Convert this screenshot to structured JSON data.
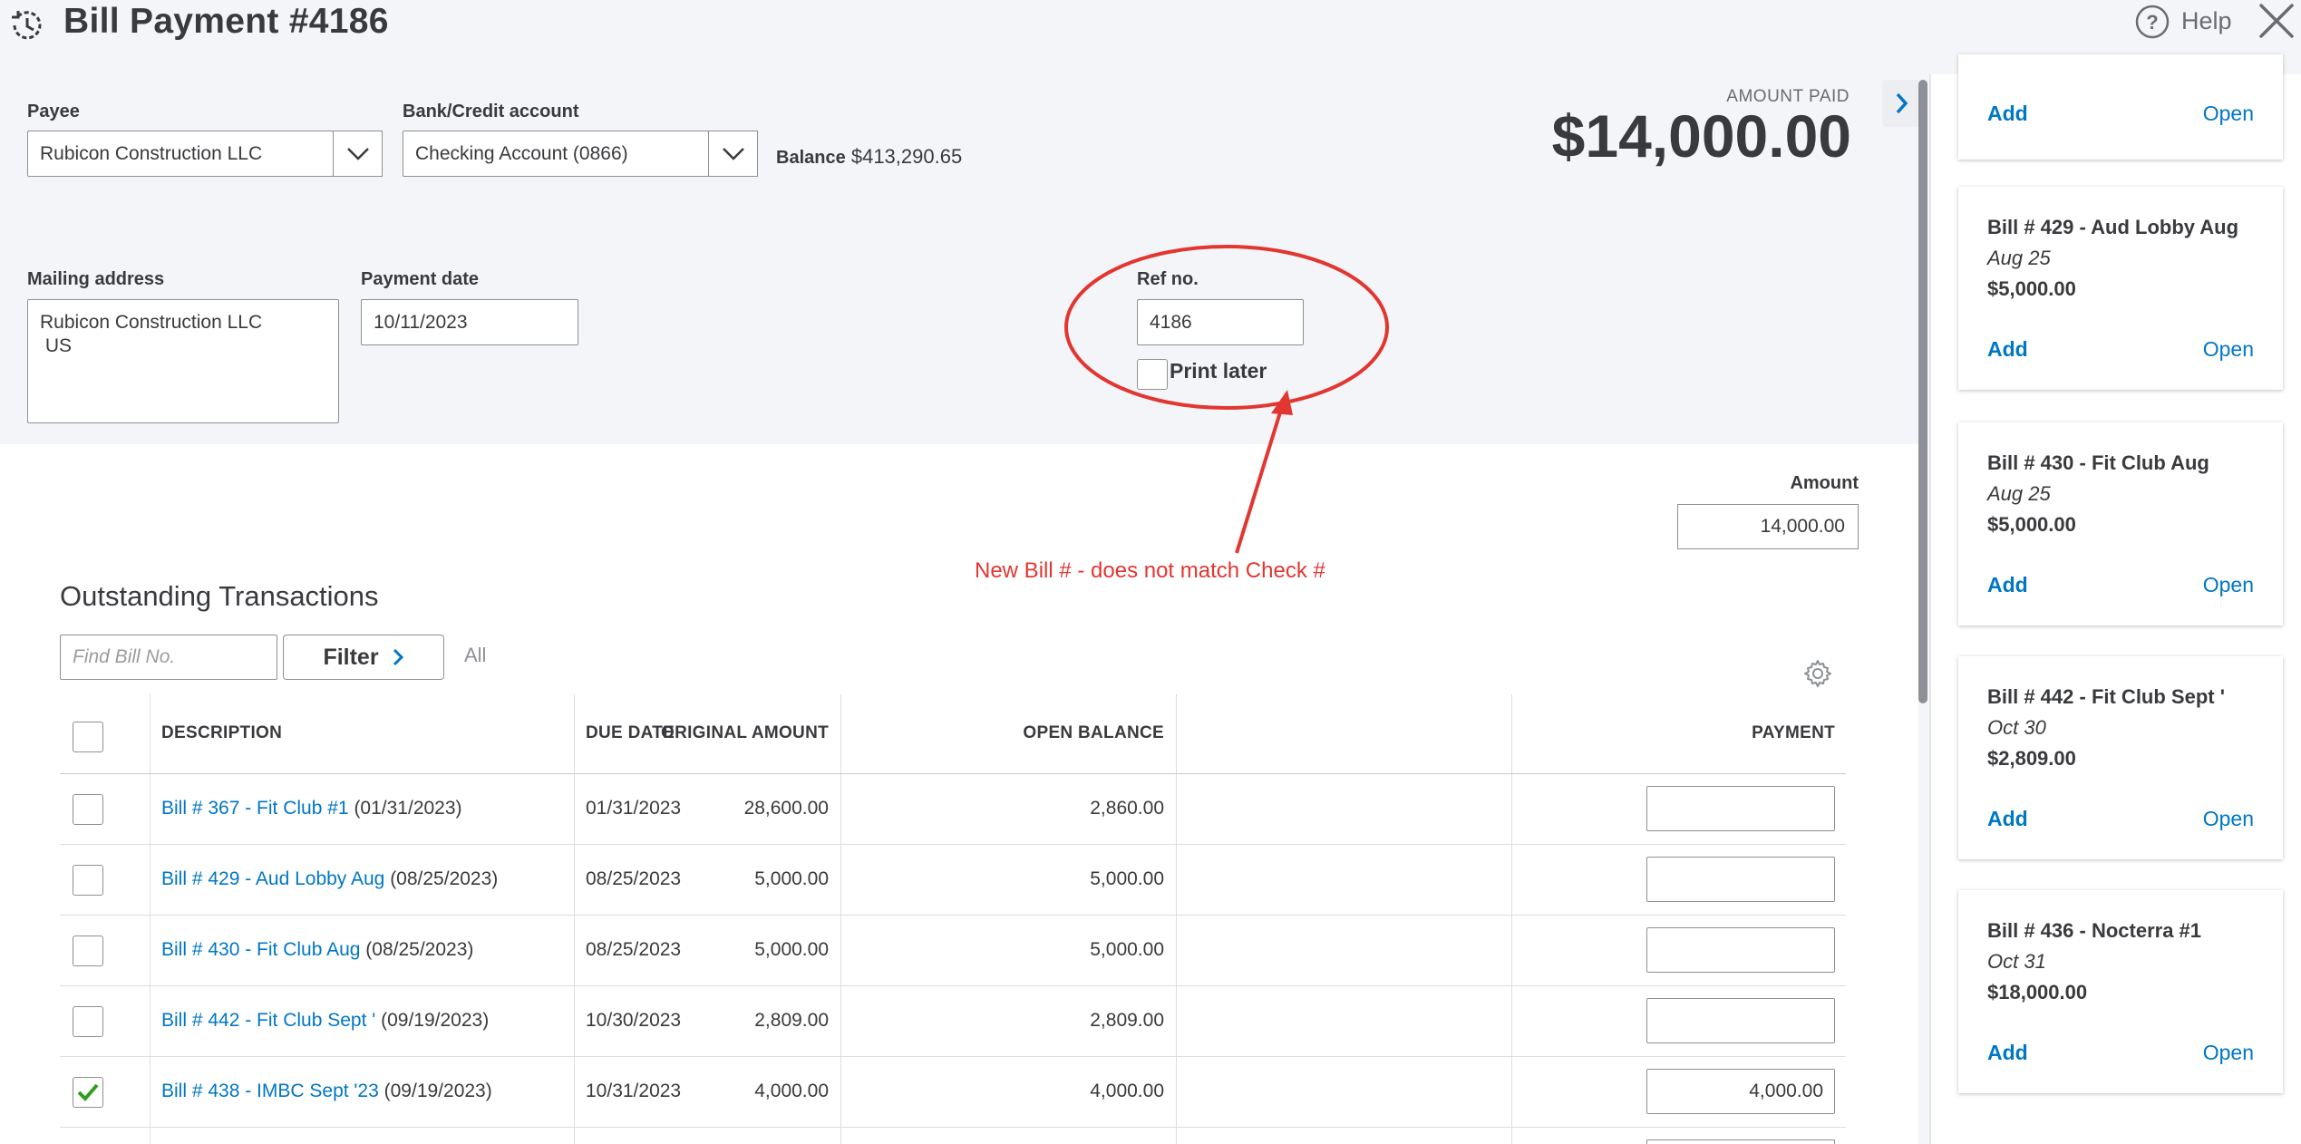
{
  "header": {
    "title": "Bill Payment #4186",
    "help_label": "Help"
  },
  "form": {
    "payee_label": "Payee",
    "payee_value": "Rubicon Construction LLC",
    "bank_label": "Bank/Credit account",
    "bank_value": "Checking Account (0866)",
    "balance_label": "Balance",
    "balance_value": "$413,290.65",
    "amount_paid_label": "AMOUNT PAID",
    "amount_paid_value": "$14,000.00",
    "mailing_label": "Mailing address",
    "mailing_line1": "Rubicon Construction LLC",
    "mailing_line2": " US",
    "payment_date_label": "Payment date",
    "payment_date_value": "10/11/2023",
    "ref_label": "Ref no.",
    "ref_value": "4186",
    "print_later_label": "Print later",
    "print_later_checked": false,
    "amount_label": "Amount",
    "amount_value": "14,000.00"
  },
  "annotation": {
    "text": "New Bill # - does not match Check #",
    "color": "#e23631"
  },
  "outstanding": {
    "title": "Outstanding Transactions",
    "find_placeholder": "Find Bill No.",
    "filter_label": "Filter",
    "all_label": "All",
    "columns": [
      "DESCRIPTION",
      "DUE DATE",
      "ORIGINAL AMOUNT",
      "OPEN BALANCE",
      "PAYMENT"
    ],
    "rows": [
      {
        "link": "Bill # 367 - Fit Club #1",
        "date_suffix": " (01/31/2023)",
        "due": "01/31/2023",
        "original": "28,600.00",
        "open": "2,860.00",
        "payment": "",
        "checked": false
      },
      {
        "link": "Bill # 429 - Aud Lobby Aug",
        "date_suffix": " (08/25/2023)",
        "due": "08/25/2023",
        "original": "5,000.00",
        "open": "5,000.00",
        "payment": "",
        "checked": false
      },
      {
        "link": "Bill # 430 - Fit Club Aug",
        "date_suffix": " (08/25/2023)",
        "due": "08/25/2023",
        "original": "5,000.00",
        "open": "5,000.00",
        "payment": "",
        "checked": false
      },
      {
        "link": "Bill # 442 - Fit Club Sept '",
        "date_suffix": " (09/19/2023)",
        "due": "10/30/2023",
        "original": "2,809.00",
        "open": "2,809.00",
        "payment": "",
        "checked": false
      },
      {
        "link": "Bill # 438 - IMBC Sept '23",
        "date_suffix": " (09/19/2023)",
        "due": "10/31/2023",
        "original": "4,000.00",
        "open": "4,000.00",
        "payment": "4,000.00",
        "checked": true
      }
    ]
  },
  "side_panel": {
    "cards": [
      {
        "title": "",
        "date": "",
        "amount": "",
        "add": "Add",
        "open": "Open"
      },
      {
        "title": "Bill # 429 - Aud Lobby Aug",
        "date": "Aug 25",
        "amount": "$5,000.00",
        "add": "Add",
        "open": "Open"
      },
      {
        "title": "Bill # 430 - Fit Club Aug",
        "date": "Aug 25",
        "amount": "$5,000.00",
        "add": "Add",
        "open": "Open"
      },
      {
        "title": "Bill # 442 - Fit Club Sept '",
        "date": "Oct 30",
        "amount": "$2,809.00",
        "add": "Add",
        "open": "Open"
      },
      {
        "title": "Bill # 436 - Nocterra #1",
        "date": "Oct 31",
        "amount": "$18,000.00",
        "add": "Add",
        "open": "Open"
      }
    ]
  },
  "colors": {
    "link": "#0077c5",
    "checkmark": "#2ca01c",
    "annotation": "#e23631"
  }
}
